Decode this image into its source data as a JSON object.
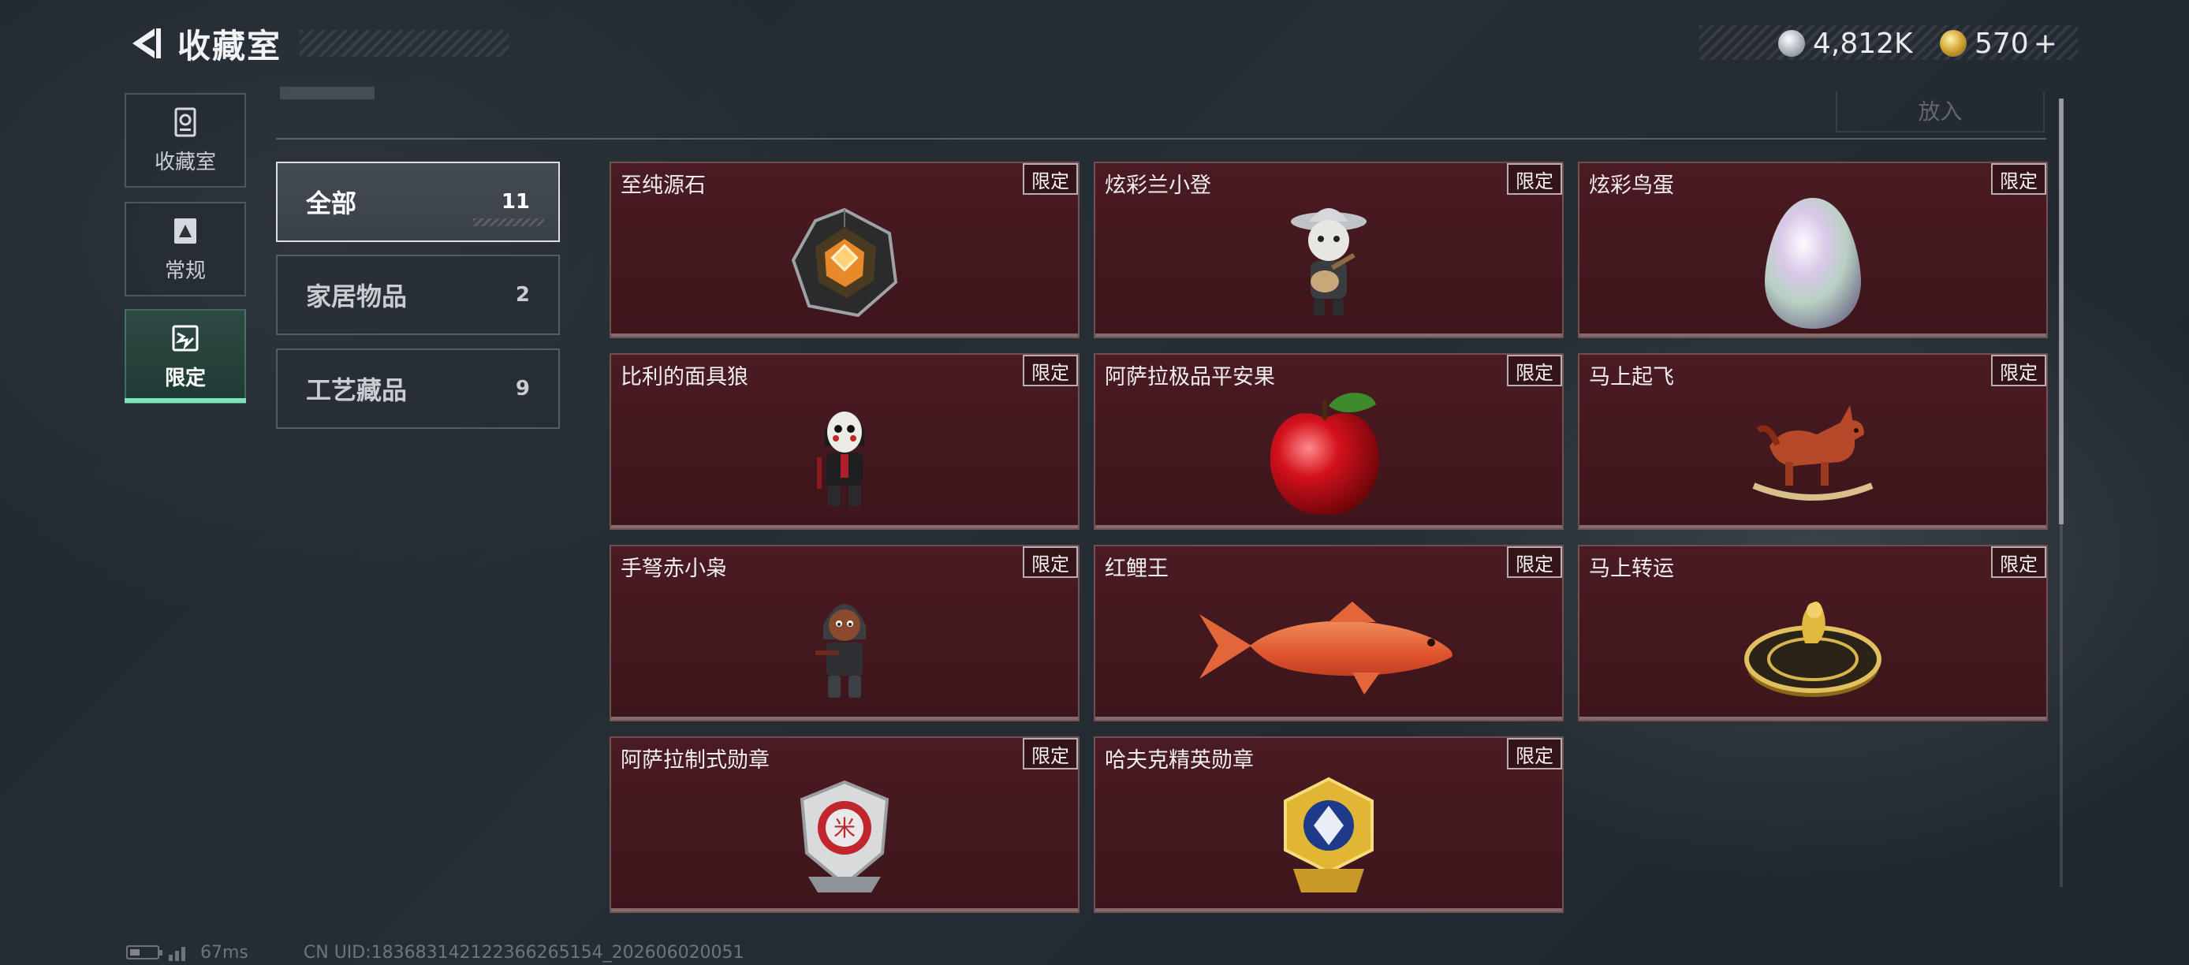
{
  "header": {
    "title": "收藏室",
    "currencies": [
      {
        "icon": "silver-coin-icon",
        "value": "4,812K"
      },
      {
        "icon": "gold-coin-icon",
        "value": "570",
        "suffix": "+"
      }
    ]
  },
  "sidebar": {
    "items": [
      {
        "label": "收藏室",
        "icon": "collection-room-icon",
        "active": false
      },
      {
        "label": "常规",
        "icon": "regular-icon",
        "active": false
      },
      {
        "label": "限定",
        "icon": "limited-icon",
        "active": true
      }
    ]
  },
  "toolbar": {
    "place_label": "放入"
  },
  "filters": [
    {
      "label": "全部",
      "count": "11",
      "active": true
    },
    {
      "label": "家居物品",
      "count": "2",
      "active": false
    },
    {
      "label": "工艺藏品",
      "count": "9",
      "active": false
    }
  ],
  "items": [
    {
      "name": "至纯源石",
      "badge": "限定",
      "icon": "crystal-icon"
    },
    {
      "name": "炫彩兰小登",
      "badge": "限定",
      "icon": "figurine-guitar-icon"
    },
    {
      "name": "炫彩鸟蛋",
      "badge": "限定",
      "icon": "egg-icon"
    },
    {
      "name": "比利的面具狼",
      "badge": "限定",
      "icon": "mask-figure-icon"
    },
    {
      "name": "阿萨拉极品平安果",
      "badge": "限定",
      "icon": "apple-icon"
    },
    {
      "name": "马上起飞",
      "badge": "限定",
      "icon": "rocking-horse-icon"
    },
    {
      "name": "手弩赤小枭",
      "badge": "限定",
      "icon": "hooded-figure-icon"
    },
    {
      "name": "红鲤王",
      "badge": "限定",
      "icon": "carp-icon"
    },
    {
      "name": "马上转运",
      "badge": "限定",
      "icon": "fortune-wheel-icon"
    },
    {
      "name": "阿萨拉制式勋章",
      "badge": "限定",
      "icon": "winged-medal-icon"
    },
    {
      "name": "哈夫克精英勋章",
      "badge": "限定",
      "icon": "gold-medal-icon"
    }
  ],
  "footer": {
    "ping": "67ms",
    "uid": "CN UID:183683142122366265154_202606020051"
  },
  "colors": {
    "card_bg": "#45181e",
    "accent_green": "#7ee3b6",
    "page_bg": "#232a31"
  }
}
